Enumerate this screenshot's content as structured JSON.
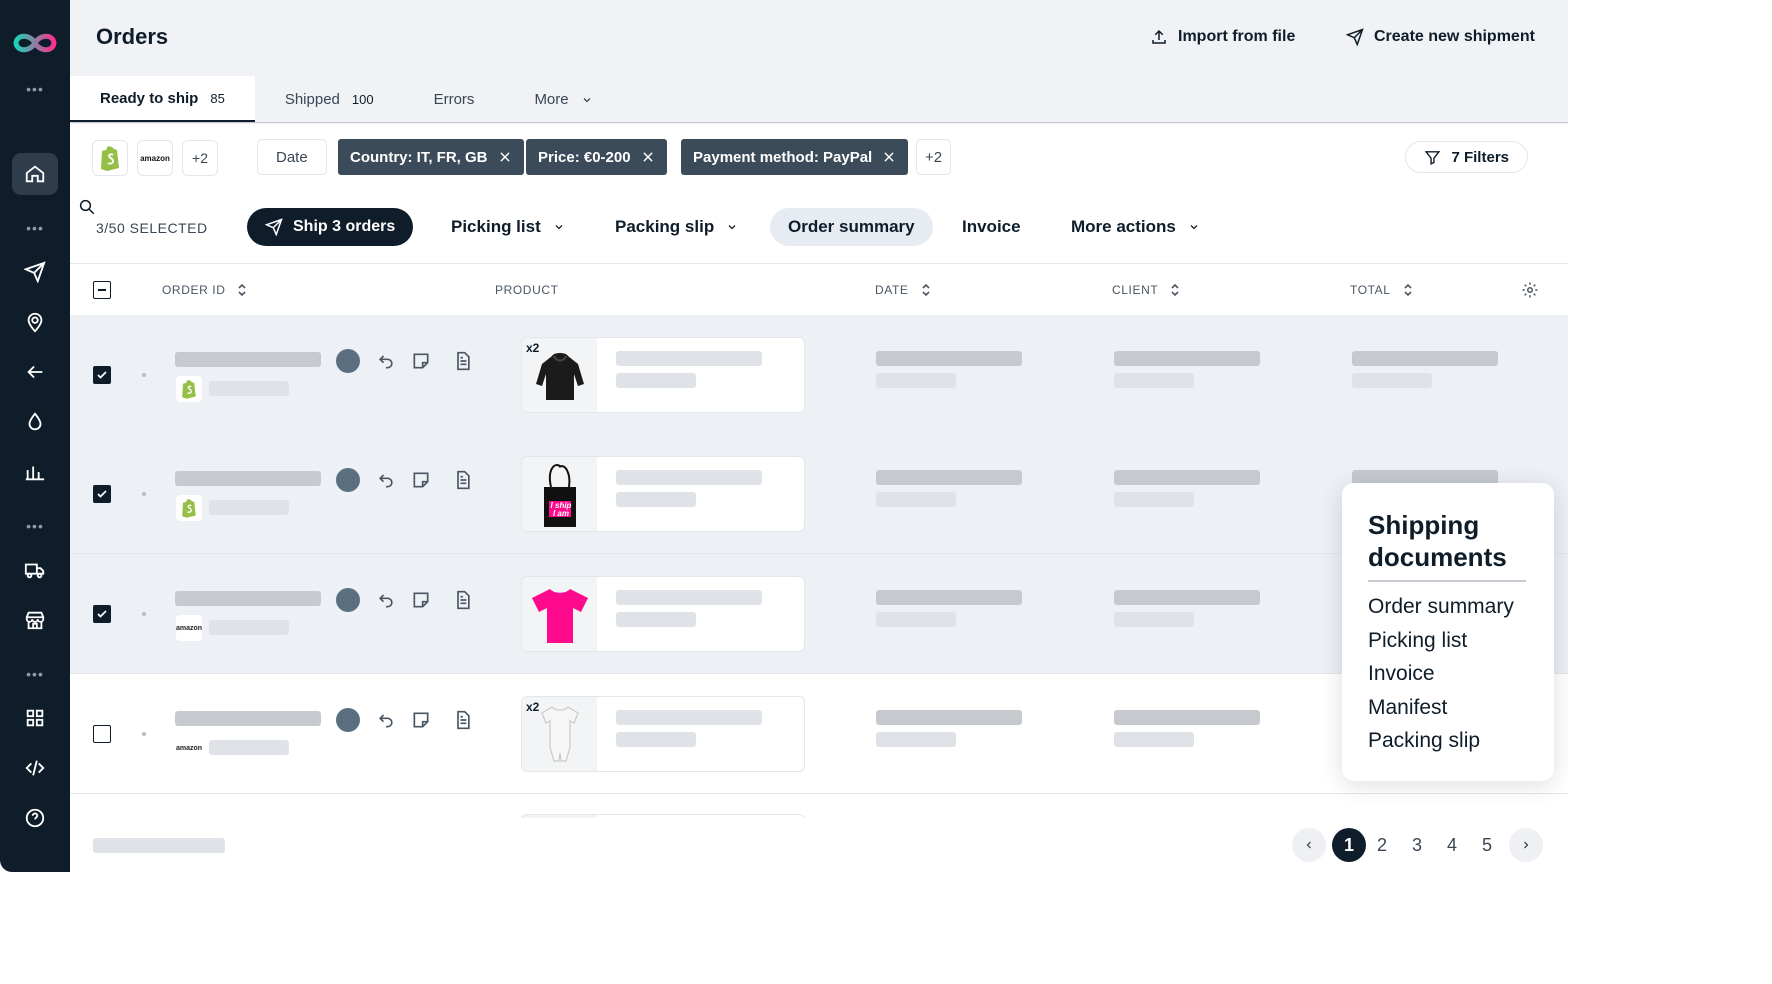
{
  "header": {
    "title": "Orders",
    "import_label": "Import from file",
    "create_label": "Create new shipment"
  },
  "tabs": [
    {
      "label": "Ready to ship",
      "count": "85",
      "active": true
    },
    {
      "label": "Shipped",
      "count": "100"
    },
    {
      "label": "Errors",
      "count": ""
    },
    {
      "label": "More",
      "count": ""
    }
  ],
  "filters": {
    "stores": [
      "shopify",
      "amazon"
    ],
    "stores_more": "+2",
    "date_label": "Date",
    "country": "Country: IT, FR, GB",
    "price": "Price: €0-200",
    "payment": "Payment method: PayPal",
    "filters_more": "+2",
    "filters_button": "7 Filters"
  },
  "actions": {
    "selected": "3/50 SELECTED",
    "ship": "Ship 3 orders",
    "picking_list": "Picking list",
    "packing_slip": "Packing slip",
    "order_summary": "Order summary",
    "invoice": "Invoice",
    "more_actions": "More actions"
  },
  "table": {
    "columns": [
      "ORDER ID",
      "PRODUCT",
      "DATE",
      "CLIENT",
      "TOTAL"
    ],
    "rows": [
      {
        "selected": true,
        "store": "shopify",
        "qty": "x2",
        "product_icon": "hoodie-icon"
      },
      {
        "selected": true,
        "store": "shopify",
        "qty": "",
        "product_icon": "tote-bag-icon",
        "tote_text": "I ship I am"
      },
      {
        "selected": true,
        "store": "amazon",
        "qty": "",
        "product_icon": "tshirt-icon"
      },
      {
        "selected": false,
        "store": "amazon",
        "qty": "x2",
        "product_icon": "onesie-icon"
      }
    ]
  },
  "popover": {
    "title": "Shipping documents",
    "items": [
      "Order summary",
      "Picking list",
      "Invoice",
      "Manifest",
      "Packing slip"
    ]
  },
  "pagination": {
    "pages": [
      "1",
      "2",
      "3",
      "4",
      "5"
    ],
    "current": "1"
  },
  "store_labels": {
    "amazon": "amazon"
  },
  "colors": {
    "dark": "#0f1d2a",
    "accent_green": "#95bf47",
    "pink": "#ff0a8c",
    "logo_teal": "#1bd3b8"
  }
}
